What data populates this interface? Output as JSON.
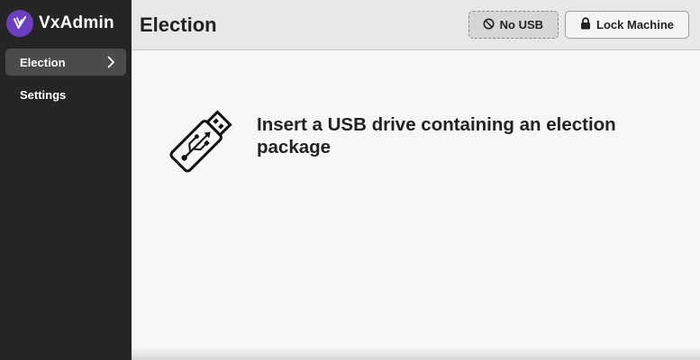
{
  "sidebar": {
    "app_name": "VxAdmin",
    "items": [
      {
        "label": "Election",
        "active": true
      },
      {
        "label": "Settings",
        "active": false
      }
    ]
  },
  "header": {
    "title": "Election",
    "usb_button_label": "No USB",
    "lock_button_label": "Lock Machine"
  },
  "main": {
    "prompt": "Insert a USB drive containing an election package"
  },
  "colors": {
    "sidebar_bg": "#252525",
    "brand_purple": "#6b3fbf",
    "header_bg": "#e8e8e6",
    "content_bg": "#f7f7f5"
  },
  "icons": [
    "vx-logo-icon",
    "chevron-right-icon",
    "no-usb-icon",
    "lock-icon",
    "usb-drive-icon"
  ]
}
